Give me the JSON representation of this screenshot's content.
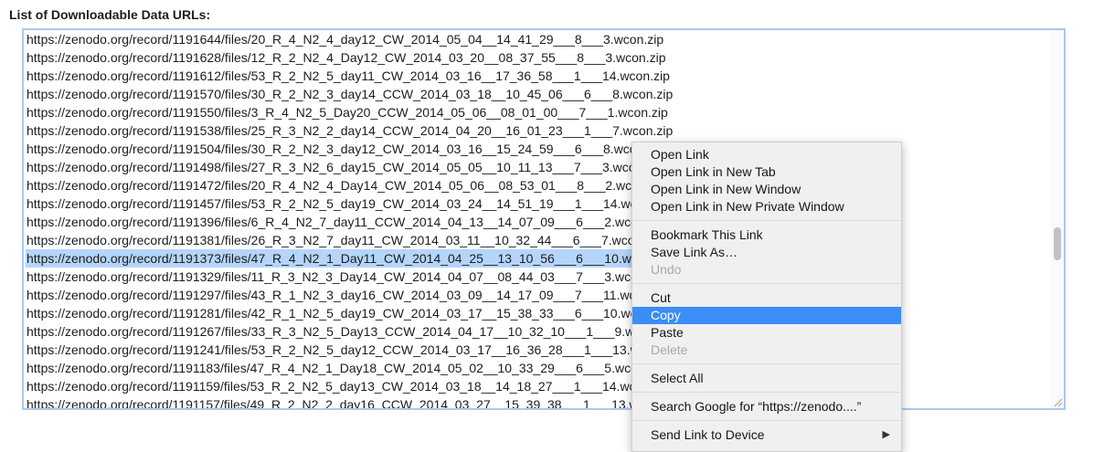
{
  "heading": "List of Downloadable Data URLs:",
  "urls": [
    "https://zenodo.org/record/1191644/files/20_R_4_N2_4_day12_CW_2014_05_04__14_41_29___8___3.wcon.zip",
    "https://zenodo.org/record/1191628/files/12_R_2_N2_4_Day12_CW_2014_03_20__08_37_55___8___3.wcon.zip",
    "https://zenodo.org/record/1191612/files/53_R_2_N2_5_day11_CW_2014_03_16__17_36_58___1___14.wcon.zip",
    "https://zenodo.org/record/1191570/files/30_R_2_N2_3_day14_CCW_2014_03_18__10_45_06___6___8.wcon.zip",
    "https://zenodo.org/record/1191550/files/3_R_4_N2_5_Day20_CCW_2014_05_06__08_01_00___7___1.wcon.zip",
    "https://zenodo.org/record/1191538/files/25_R_3_N2_2_day14_CCW_2014_04_20__16_01_23___1___7.wcon.zip",
    "https://zenodo.org/record/1191504/files/30_R_2_N2_3_day12_CW_2014_03_16__15_24_59___6___8.wco",
    "https://zenodo.org/record/1191498/files/27_R_3_N2_6_day15_CW_2014_05_05__10_11_13___7___3.wco",
    "https://zenodo.org/record/1191472/files/20_R_4_N2_4_Day14_CW_2014_05_06__08_53_01___8___2.wco",
    "https://zenodo.org/record/1191457/files/53_R_2_N2_5_day19_CW_2014_03_24__14_51_19___1___14.wc",
    "https://zenodo.org/record/1191396/files/6_R_4_N2_7_day11_CCW_2014_04_13__14_07_09___6___2.wco",
    "https://zenodo.org/record/1191381/files/26_R_3_N2_7_day11_CW_2014_03_11__10_32_44___6___7.wco",
    "https://zenodo.org/record/1191373/files/47_R_4_N2_1_Day11_CW_2014_04_25__13_10_56___6___10.wc",
    "https://zenodo.org/record/1191329/files/11_R_3_N2_3_Day14_CW_2014_04_07__08_44_03___7___3.wco",
    "https://zenodo.org/record/1191297/files/43_R_1_N2_3_day16_CW_2014_03_09__14_17_09___7___11.wc",
    "https://zenodo.org/record/1191281/files/42_R_1_N2_5_day19_CW_2014_03_17__15_38_33___6___10.wc",
    "https://zenodo.org/record/1191267/files/33_R_3_N2_5_Day13_CCW_2014_04_17__10_32_10___1___9.w",
    "https://zenodo.org/record/1191241/files/53_R_2_N2_5_day12_CCW_2014_03_17__16_36_28___1___13.w",
    "https://zenodo.org/record/1191183/files/47_R_4_N2_1_Day18_CW_2014_05_02__10_33_29___6___5.wco",
    "https://zenodo.org/record/1191159/files/53_R_2_N2_5_day13_CW_2014_03_18__14_18_27___1___14.wc",
    "https://zenodo.org/record/1191157/files/49_R_2_N2_2_day16_CCW_2014_03_27__15_39_38___1___13.w"
  ],
  "selected_url_index": 12,
  "context_menu": {
    "items": [
      {
        "label": "Open Link",
        "name": "menu-open-link",
        "state": "normal"
      },
      {
        "label": "Open Link in New Tab",
        "name": "menu-open-link-new-tab",
        "state": "normal"
      },
      {
        "label": "Open Link in New Window",
        "name": "menu-open-link-new-window",
        "state": "normal"
      },
      {
        "label": "Open Link in New Private Window",
        "name": "menu-open-link-private-window",
        "state": "normal"
      },
      {
        "separator": true
      },
      {
        "label": "Bookmark This Link",
        "name": "menu-bookmark-link",
        "state": "normal"
      },
      {
        "label": "Save Link As…",
        "name": "menu-save-link-as",
        "state": "normal"
      },
      {
        "label": "Undo",
        "name": "menu-undo",
        "state": "disabled"
      },
      {
        "separator": true
      },
      {
        "label": "Cut",
        "name": "menu-cut",
        "state": "normal"
      },
      {
        "label": "Copy",
        "name": "menu-copy",
        "state": "highlighted"
      },
      {
        "label": "Paste",
        "name": "menu-paste",
        "state": "normal"
      },
      {
        "label": "Delete",
        "name": "menu-delete",
        "state": "disabled"
      },
      {
        "separator": true
      },
      {
        "label": "Select All",
        "name": "menu-select-all",
        "state": "normal"
      },
      {
        "separator": true
      },
      {
        "label": "Search Google for “https://zenodo....”",
        "name": "menu-search-google",
        "state": "normal"
      },
      {
        "separator": true
      },
      {
        "label": "Send Link to Device",
        "name": "menu-send-link-to-device",
        "state": "normal",
        "submenu": true
      }
    ]
  },
  "colors": {
    "selection": "#b5d5fb",
    "menu_highlight": "#3a8ef5",
    "focus_border": "#a8c8f0"
  },
  "icons": {
    "submenu_arrow": "▶",
    "resize_grip": "resize-grip-icon"
  }
}
